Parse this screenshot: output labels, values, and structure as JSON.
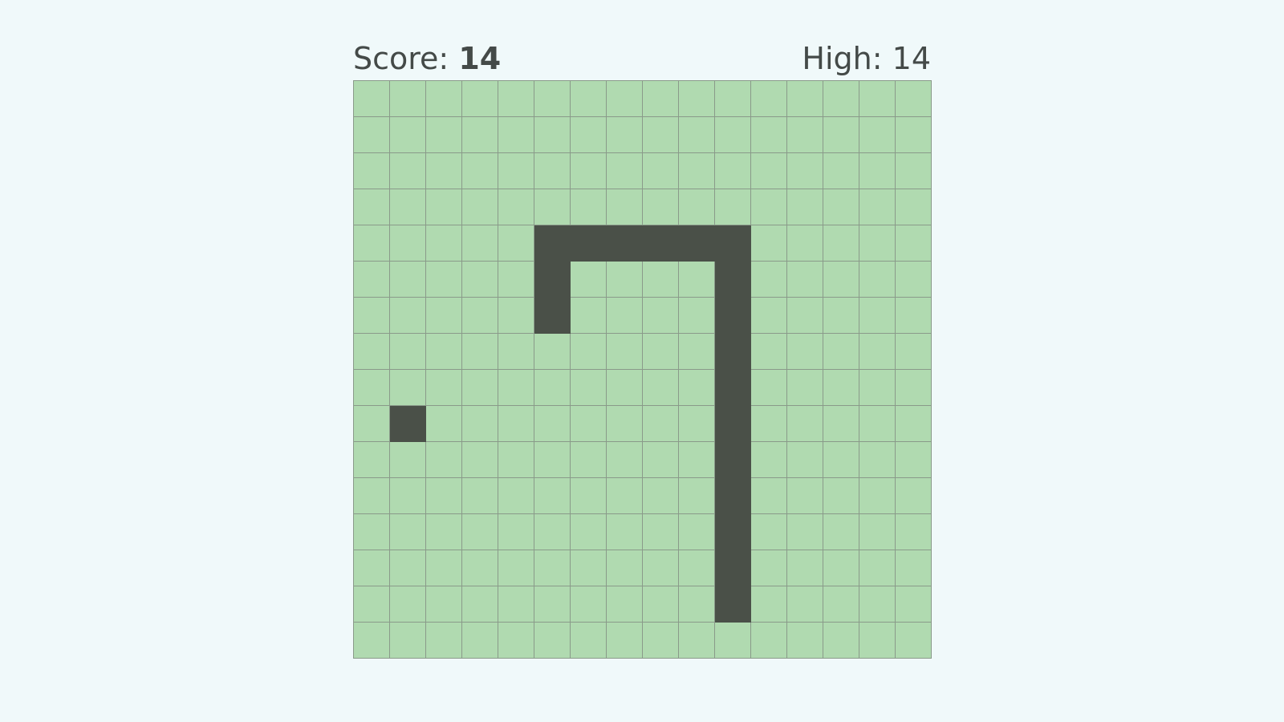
{
  "hud": {
    "score_label": "Score:",
    "score_value": "14",
    "high_label": "High:",
    "high_value": "14"
  },
  "board": {
    "columns": 16,
    "rows": 16,
    "snake": [
      [
        10,
        14
      ],
      [
        10,
        13
      ],
      [
        10,
        12
      ],
      [
        10,
        11
      ],
      [
        10,
        10
      ],
      [
        10,
        9
      ],
      [
        10,
        8
      ],
      [
        10,
        7
      ],
      [
        10,
        6
      ],
      [
        10,
        5
      ],
      [
        10,
        4
      ],
      [
        9,
        4
      ],
      [
        8,
        4
      ],
      [
        7,
        4
      ],
      [
        6,
        4
      ],
      [
        5,
        4
      ],
      [
        5,
        5
      ],
      [
        5,
        6
      ]
    ],
    "food": [
      1,
      9
    ]
  },
  "colors": {
    "background": "#f0f9fa",
    "cell": "#b0dab0",
    "grid_line": "#8a9a8a",
    "snake": "#4a5048",
    "food": "#4a5048",
    "text": "#444a48"
  }
}
